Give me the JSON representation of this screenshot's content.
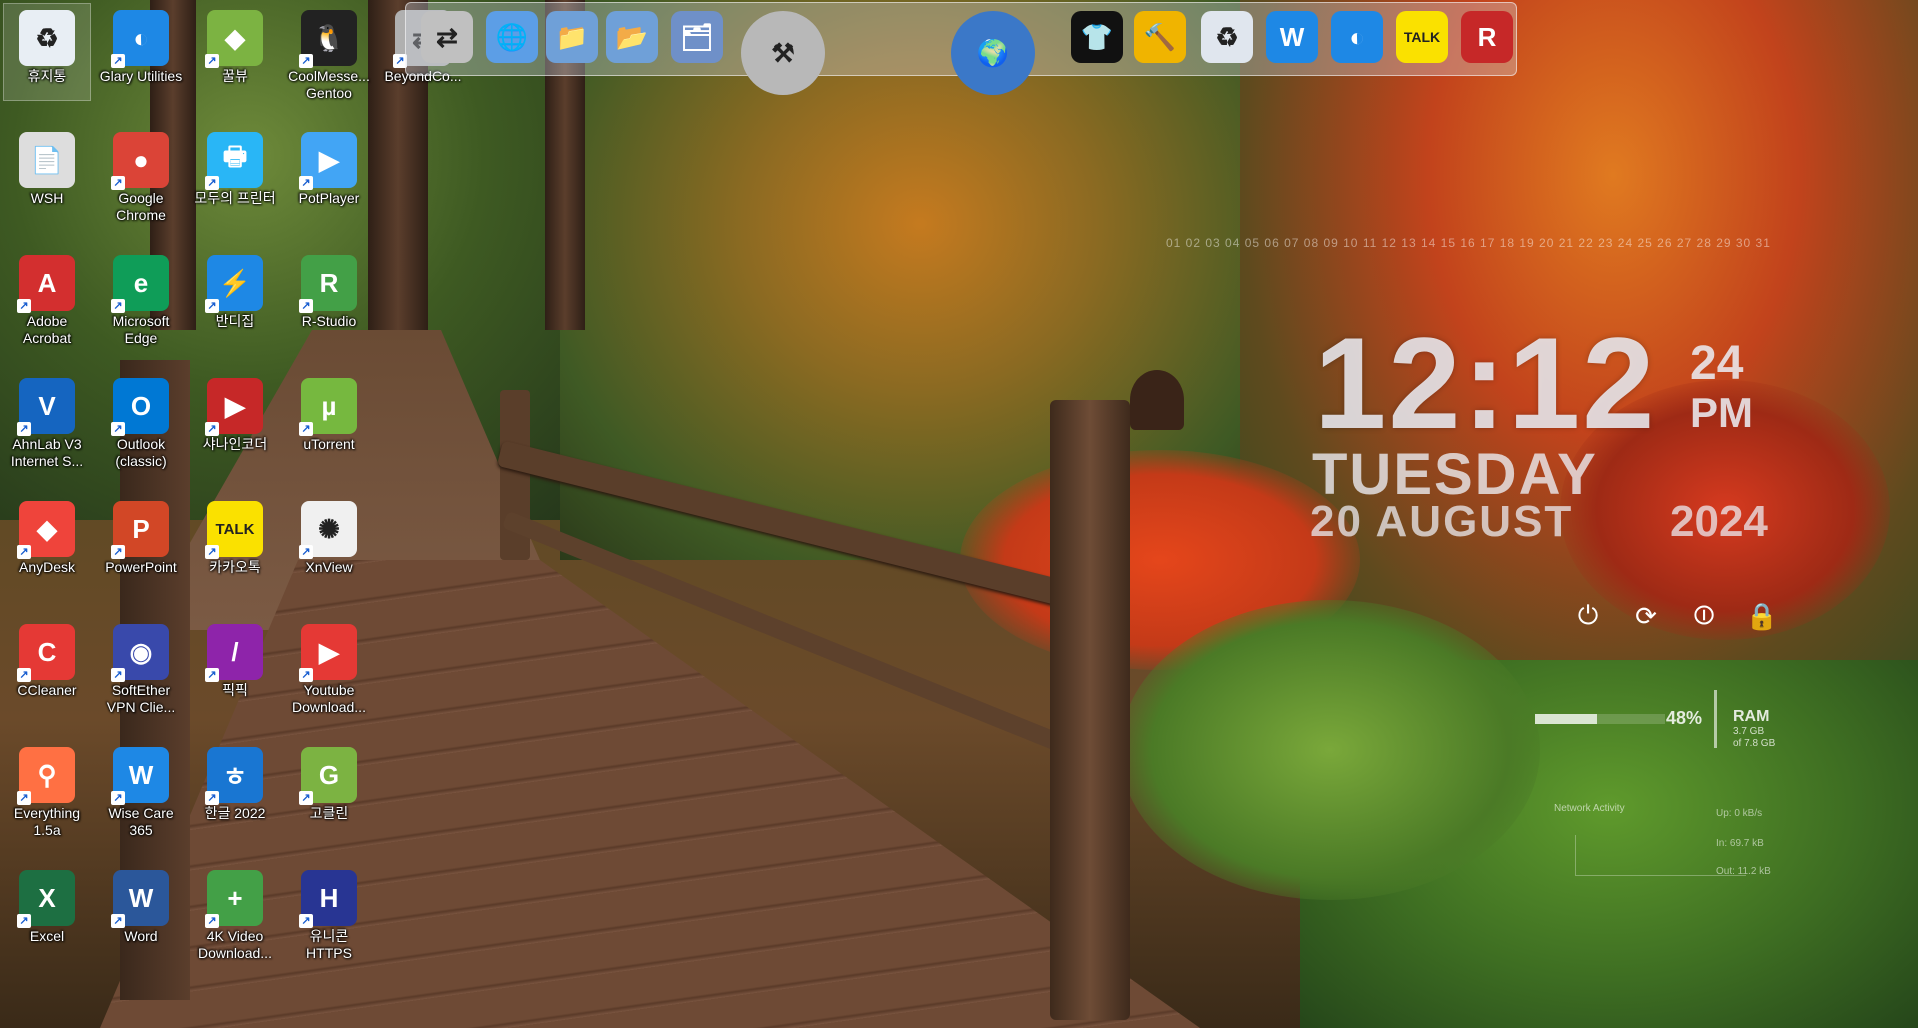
{
  "desktop_icons": [
    {
      "label": "휴지통",
      "icon": "recycle-bin-icon",
      "color": "#e8eef4"
    },
    {
      "label": "Glary Utilities",
      "icon": "glary-icon",
      "color": "#1e88e5"
    },
    {
      "label": "꿀뷰",
      "icon": "honeyview-icon",
      "color": "#7cb342"
    },
    {
      "label": "CoolMesse... Gentoo",
      "icon": "penguin-icon",
      "color": "#222222"
    },
    {
      "label": "BeyondCo...",
      "icon": "beyondcompare-icon",
      "color": "#b0b0b0"
    },
    {
      "label": "WSH",
      "icon": "file-icon",
      "color": "#dddddd"
    },
    {
      "label": "Google Chrome",
      "icon": "chrome-icon",
      "color": "#db4437"
    },
    {
      "label": "모두의 프린터",
      "icon": "printer-icon",
      "color": "#29b6f6"
    },
    {
      "label": "PotPlayer",
      "icon": "potplayer-icon",
      "color": "#42a5f5"
    },
    {
      "label": "Adobe Acrobat",
      "icon": "acrobat-icon",
      "color": "#d32f2f"
    },
    {
      "label": "Microsoft Edge",
      "icon": "edge-icon",
      "color": "#0f9d58"
    },
    {
      "label": "반디집",
      "icon": "bandizip-icon",
      "color": "#1e88e5"
    },
    {
      "label": "R-Studio",
      "icon": "rstudio-icon",
      "color": "#43a047"
    },
    {
      "label": "AhnLab V3 Internet S...",
      "icon": "v3-icon",
      "color": "#1565c0"
    },
    {
      "label": "Outlook (classic)",
      "icon": "outlook-icon",
      "color": "#0078d4"
    },
    {
      "label": "샤나인코더",
      "icon": "shana-icon",
      "color": "#c62828"
    },
    {
      "label": "uTorrent",
      "icon": "utorrent-icon",
      "color": "#76b83f"
    },
    {
      "label": "AnyDesk",
      "icon": "anydesk-icon",
      "color": "#ef443b"
    },
    {
      "label": "PowerPoint",
      "icon": "powerpoint-icon",
      "color": "#d24726"
    },
    {
      "label": "카카오톡",
      "icon": "kakaotalk-icon",
      "color": "#fae100"
    },
    {
      "label": "XnView",
      "icon": "xnview-icon",
      "color": "#f0f0f0"
    },
    {
      "label": "CCleaner",
      "icon": "ccleaner-icon",
      "color": "#e53935"
    },
    {
      "label": "SoftEther VPN Clie...",
      "icon": "softether-icon",
      "color": "#3949ab"
    },
    {
      "label": "픽픽",
      "icon": "picpick-icon",
      "color": "#8e24aa"
    },
    {
      "label": "Youtube Download...",
      "icon": "youtube-downloader-icon",
      "color": "#e53935"
    },
    {
      "label": "Everything 1.5a",
      "icon": "everything-icon",
      "color": "#ff7043"
    },
    {
      "label": "Wise Care 365",
      "icon": "wisecare-icon",
      "color": "#1e88e5"
    },
    {
      "label": "한글 2022",
      "icon": "hangul-icon",
      "color": "#1976d2"
    },
    {
      "label": "고클린",
      "icon": "goclean-icon",
      "color": "#7cb342"
    },
    {
      "label": "Excel",
      "icon": "excel-icon",
      "color": "#1d6f42"
    },
    {
      "label": "Word",
      "icon": "word-icon",
      "color": "#2b579a"
    },
    {
      "label": "4K Video Download...",
      "icon": "4k-video-downloader-icon",
      "color": "#43a047"
    },
    {
      "label": "유니콘 HTTPS",
      "icon": "unicorn-https-icon",
      "color": "#283593"
    }
  ],
  "dock": {
    "items": [
      {
        "icon": "beyondcompare-icon",
        "color": "#c0c0c0"
      },
      {
        "icon": "globe-document-icon",
        "color": "#5c9ee6"
      },
      {
        "icon": "folder-icon",
        "color": "#6fa0d8"
      },
      {
        "icon": "folder-open-icon",
        "color": "#6fa0d8"
      },
      {
        "icon": "folder-network-icon",
        "color": "#6f90c8"
      },
      {
        "icon": "tools-icon",
        "color": "#b8b8b8"
      },
      {
        "icon": "globe-icon",
        "color": "#3b78c8"
      },
      {
        "icon": "tshirt-icon",
        "color": "#111111"
      },
      {
        "icon": "hammer-icon",
        "color": "#f0b400"
      },
      {
        "icon": "recycle-bin-icon",
        "color": "#e0e6ee"
      },
      {
        "icon": "wisecare-icon",
        "color": "#1e88e5"
      },
      {
        "icon": "glary-icon",
        "color": "#1e88e5"
      },
      {
        "icon": "kakaotalk-icon",
        "color": "#fae100"
      },
      {
        "icon": "rstudio-icon",
        "color": "#c62828"
      }
    ],
    "kakao_text": "TALK",
    "r_text": "R"
  },
  "clock": {
    "hours_minutes": "12:12",
    "seconds": "24",
    "ampm": "PM",
    "day": "TUESDAY",
    "date": "20 AUGUST",
    "year": "2024",
    "calendar_month": "08",
    "calendar_days": "01 02 03 04 05 06 07 08 09 10 11 12 13 14 15 16 17 18 19 20 21 22 23 24 25 26 27 28 29 30 31"
  },
  "power_buttons": [
    {
      "icon": "power-icon",
      "glyph": "⏻"
    },
    {
      "icon": "restart-icon",
      "glyph": "⟳"
    },
    {
      "icon": "logoff-icon",
      "glyph": "⏼"
    },
    {
      "icon": "lock-icon",
      "glyph": "🔒"
    }
  ],
  "ram": {
    "percent": "48%",
    "percent_value": 48,
    "label": "RAM",
    "used": "3.7 GB",
    "total": "of 7.8 GB"
  },
  "network": {
    "title": "Network Activity",
    "rows": [
      "Up: 0 kB/s",
      "In: 69.7 kB",
      "Out: 11.2 kB"
    ]
  }
}
